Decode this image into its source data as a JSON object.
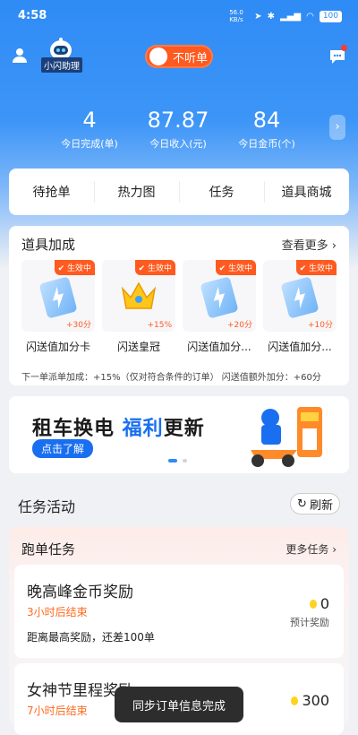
{
  "status_bar": {
    "time": "4:58",
    "net_speed": "56.0 KB/s",
    "battery": "100"
  },
  "header": {
    "assistant_label": "小闪助理",
    "toggle_label": "不听单"
  },
  "stats": [
    {
      "value": "4",
      "label": "今日完成(单)"
    },
    {
      "value": "87.87",
      "label": "今日收入(元)"
    },
    {
      "value": "84",
      "label": "今日金币(个)"
    }
  ],
  "nav_tabs": [
    "待抢单",
    "热力图",
    "任务",
    "道具商城"
  ],
  "props": {
    "title": "道具加成",
    "more": "查看更多",
    "items": [
      {
        "name": "闪送值加分卡",
        "badge": "生效中",
        "bonus": "+30分"
      },
      {
        "name": "闪送皇冠",
        "badge": "生效中",
        "bonus": "+15%"
      },
      {
        "name": "闪送值加分...",
        "badge": "生效中",
        "bonus": "+20分"
      },
      {
        "name": "闪送值加分...",
        "badge": "生效中",
        "bonus": "+10分"
      }
    ],
    "footer": "下一单派单加成：+15%（仅对符合条件的订单）  闪送值额外加分：+60分"
  },
  "banner": {
    "title_a": "租车换电 ",
    "title_b": "福利",
    "title_c": "更新",
    "button": "点击了解"
  },
  "tasks": {
    "title": "任务活动",
    "refresh": "刷新",
    "section_title": "跑单任务",
    "section_more": "更多任务",
    "items": [
      {
        "name": "晚高峰金币奖励",
        "deadline": "3小时后结束",
        "progress": "距离最高奖励，还差100单",
        "coins": "0",
        "reward_label": "预计奖励"
      },
      {
        "name": "女神节里程奖励",
        "deadline": "7小时后结束",
        "progress": "",
        "coins": "300",
        "reward_label": ""
      }
    ]
  },
  "toast": "同步订单信息完成",
  "colors": {
    "primary": "#2f8bf5",
    "accent": "#ff5a1f",
    "toggle": "#ff5a1f"
  }
}
